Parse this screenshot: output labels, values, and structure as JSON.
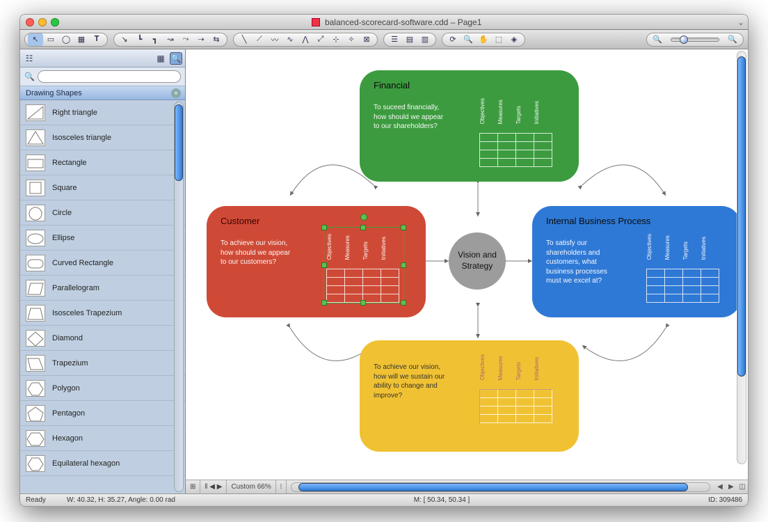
{
  "window": {
    "title": "balanced-scorecard-software.cdd – Page1"
  },
  "toolbar": {
    "tools": [
      "pointer",
      "rect",
      "ellipse",
      "table",
      "text"
    ],
    "connectors": [
      "line",
      "orth",
      "curve",
      "arc",
      "elbow",
      "multi",
      "route"
    ],
    "extras": [
      "straight",
      "poly",
      "curve2",
      "bezier",
      "path",
      "dim",
      "snap",
      "sep",
      "calc"
    ],
    "view": [
      "align",
      "dist",
      "group"
    ],
    "nav": [
      "refresh",
      "zoom",
      "hand",
      "marquee",
      "layers"
    ],
    "zoom": {
      "out": "–",
      "in": "+"
    }
  },
  "sidebar": {
    "search_placeholder": "",
    "section": "Drawing Shapes",
    "shapes": [
      "Right triangle",
      "Isosceles triangle",
      "Rectangle",
      "Square",
      "Circle",
      "Ellipse",
      "Curved Rectangle",
      "Parallelogram",
      "Isosceles Trapezium",
      "Diamond",
      "Trapezium",
      "Polygon",
      "Pentagon",
      "Hexagon",
      "Equilateral hexagon"
    ]
  },
  "diagram": {
    "center": "Vision and Strategy",
    "columns": [
      "Objectives",
      "Measures",
      "Targets",
      "Initiatives"
    ],
    "cards": {
      "financial": {
        "title": "Financial",
        "desc": "To suceed financially, how should we appear to our shareholders?",
        "color": "#3c9b3f"
      },
      "customer": {
        "title": "Customer",
        "desc": "To achieve our vision, how should we appear to our customers?",
        "color": "#cf4a36"
      },
      "internal": {
        "title": "Internal Business Process",
        "desc": "To satisfy our shareholders and customers, what business processes must we excel at?",
        "color": "#2f79d6"
      },
      "learning": {
        "title": "",
        "desc": "To achieve our vision, how will we sustain our ability to change and improve?",
        "color": "#f0c233"
      }
    }
  },
  "footer": {
    "zoom": "Custom 66%"
  },
  "status": {
    "ready": "Ready",
    "wh": "W: 40.32,  H: 35.27,  Angle: 0.00 rad",
    "m": "M: [ 50.34, 50.34 ]",
    "id": "ID: 309486"
  }
}
